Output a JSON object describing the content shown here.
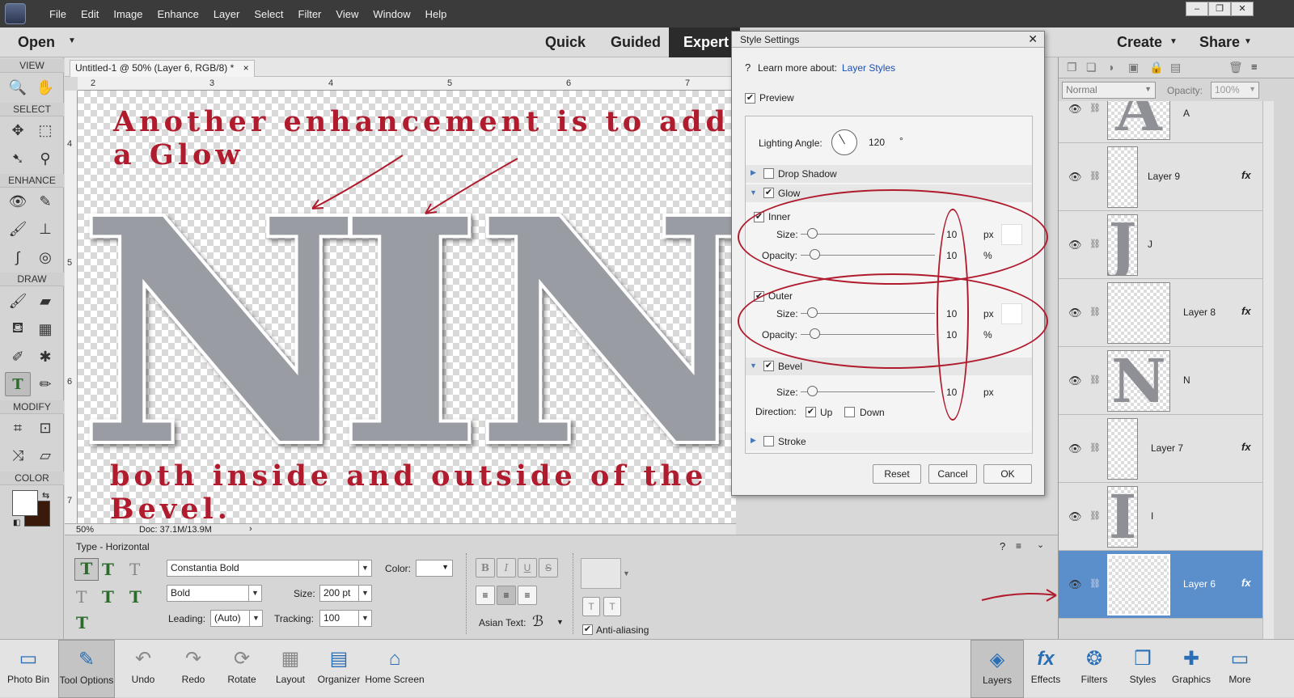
{
  "menubar": {
    "items": [
      "File",
      "Edit",
      "Image",
      "Enhance",
      "Layer",
      "Select",
      "Filter",
      "View",
      "Window",
      "Help"
    ],
    "window_buttons": [
      "–",
      "❐",
      "✕"
    ]
  },
  "modebar": {
    "open_label": "Open",
    "modes": [
      "Quick",
      "Guided",
      "Expert"
    ],
    "create_label": "Create",
    "share_label": "Share"
  },
  "left_tools": {
    "sections": [
      "VIEW",
      "SELECT",
      "ENHANCE",
      "DRAW",
      "MODIFY",
      "COLOR"
    ]
  },
  "document": {
    "tab_title": "Untitled-1 @ 50% (Layer 6, RGB/8) *",
    "ruler_h": [
      "2",
      "3",
      "4",
      "5",
      "6",
      "7"
    ],
    "ruler_v": [
      "4",
      "5",
      "6",
      "7"
    ],
    "canvas_text_top": "Another enhancement is to add a Glow",
    "canvas_text_bottom": "both inside and outside of the Bevel.",
    "canvas_letters": [
      "N",
      "I",
      "N"
    ]
  },
  "statusbar": {
    "zoom": "50%",
    "doc": "Doc: 37.1M/13.9M"
  },
  "tool_options": {
    "title": "Type - Horizontal",
    "font": "Constantia Bold",
    "style": "Bold",
    "size_label": "Size:",
    "size_value": "200 pt",
    "leading_label": "Leading:",
    "leading_value": "(Auto)",
    "tracking_label": "Tracking:",
    "tracking_value": "100",
    "color_label": "Color:",
    "asian_text_label": "Asian Text:",
    "anti_aliasing_label": "Anti-aliasing",
    "format_buttons": [
      "B",
      "I",
      "U",
      "S"
    ]
  },
  "dialog": {
    "title": "Style Settings",
    "learn_more": "Learn more about:",
    "learn_link": "Layer Styles",
    "preview_label": "Preview",
    "lighting_label": "Lighting Angle:",
    "lighting_value": "120",
    "lighting_unit": "°",
    "drop_shadow_label": "Drop Shadow",
    "glow_label": "Glow",
    "inner_label": "Inner",
    "outer_label": "Outer",
    "size_label": "Size:",
    "opacity_label": "Opacity:",
    "inner_size": "10",
    "inner_opacity": "10",
    "outer_size": "10",
    "outer_opacity": "10",
    "px": "px",
    "pct": "%",
    "bevel_label": "Bevel",
    "bevel_size": "10",
    "direction_label": "Direction:",
    "up_label": "Up",
    "down_label": "Down",
    "stroke_label": "Stroke",
    "reset_label": "Reset",
    "cancel_label": "Cancel",
    "ok_label": "OK",
    "glow_size_level": 0.05,
    "glow_opacity_level": 0.07,
    "bevel_size_level": 0.05
  },
  "layers_panel": {
    "blend_mode": "Normal",
    "opacity_label": "Opacity:",
    "opacity_value": "100%",
    "layers": [
      {
        "name": "A",
        "letter": "A",
        "fx": ""
      },
      {
        "name": "Layer 9",
        "letter": "",
        "fx": "fx"
      },
      {
        "name": "J",
        "letter": "J",
        "fx": ""
      },
      {
        "name": "Layer 8",
        "letter": "",
        "fx": "fx"
      },
      {
        "name": "N",
        "letter": "N",
        "fx": ""
      },
      {
        "name": "Layer 7",
        "letter": "",
        "fx": "fx"
      },
      {
        "name": "I",
        "letter": "I",
        "fx": ""
      },
      {
        "name": "Layer 6",
        "letter": "",
        "fx": "fx"
      }
    ]
  },
  "bottombar": {
    "left": [
      "Photo Bin",
      "Tool Options",
      "Undo",
      "Redo",
      "Rotate",
      "Layout",
      "Organizer",
      "Home Screen"
    ],
    "right": [
      "Layers",
      "Effects",
      "Filters",
      "Styles",
      "Graphics",
      "More"
    ]
  },
  "colors": {
    "annotation_red": "#b01c2e",
    "selected_layer": "#5a8fcc",
    "link_blue": "#1a4fb5"
  }
}
